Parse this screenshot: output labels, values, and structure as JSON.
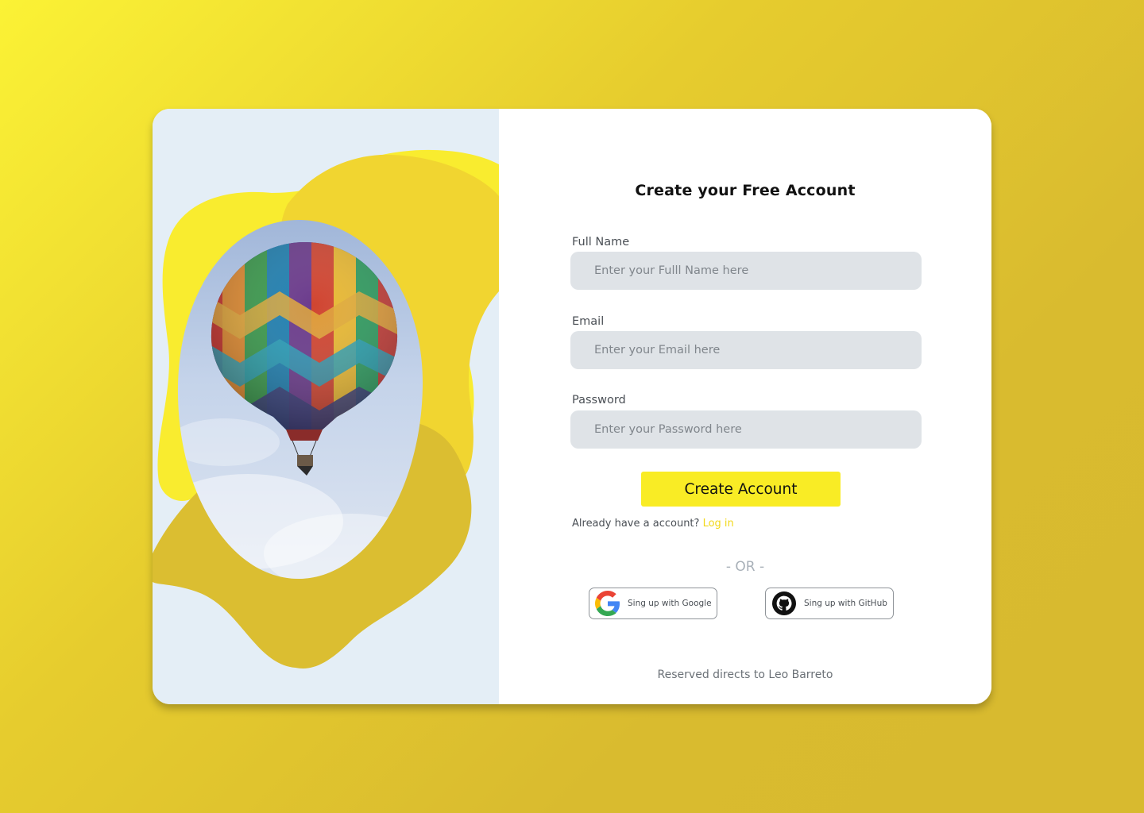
{
  "colors": {
    "background_start": "#fbf235",
    "background_end": "#d8ba2f",
    "accent_yellow": "#f9ec25",
    "link_yellow": "#f2d81b",
    "input_background": "#dfe3e7",
    "left_panel_background": "#e4eef6"
  },
  "hero": {
    "image": "hot-air-balloon-photo",
    "shapes": [
      "yellow-blob",
      "gold-blob"
    ]
  },
  "form": {
    "title": "Create your Free Account",
    "fields": [
      {
        "label": "Full Name",
        "placeholder": "Enter your Fulll Name here",
        "value": ""
      },
      {
        "label": "Email",
        "placeholder": "Enter your Email here",
        "value": ""
      },
      {
        "label": "Password",
        "placeholder": "Enter your Password here",
        "value": ""
      }
    ],
    "submit_label": "Create Account",
    "login_prompt": "Already have a account?",
    "login_link": "Log in",
    "separator": "- OR -",
    "social": [
      {
        "label": "Sing up with Google",
        "icon": "google-icon"
      },
      {
        "label": "Sing up with GitHub",
        "icon": "github-icon"
      }
    ]
  },
  "footer": {
    "text": "Reserved directs to Leo Barreto"
  }
}
